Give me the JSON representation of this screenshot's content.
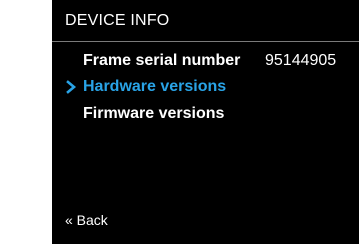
{
  "screen": {
    "title": "DEVICE INFO"
  },
  "menu": {
    "items": [
      {
        "label": "Frame serial number",
        "value": "95144905",
        "selected": false
      },
      {
        "label": "Hardware versions",
        "selected": true
      },
      {
        "label": "Firmware versions",
        "selected": false
      }
    ]
  },
  "footer": {
    "back_label": "« Back"
  },
  "colors": {
    "background": "#000000",
    "text": "#ffffff",
    "accent": "#29a3e6",
    "divider": "#7a7a7a"
  },
  "icons": {
    "selection_indicator": "chevron-right-icon"
  }
}
